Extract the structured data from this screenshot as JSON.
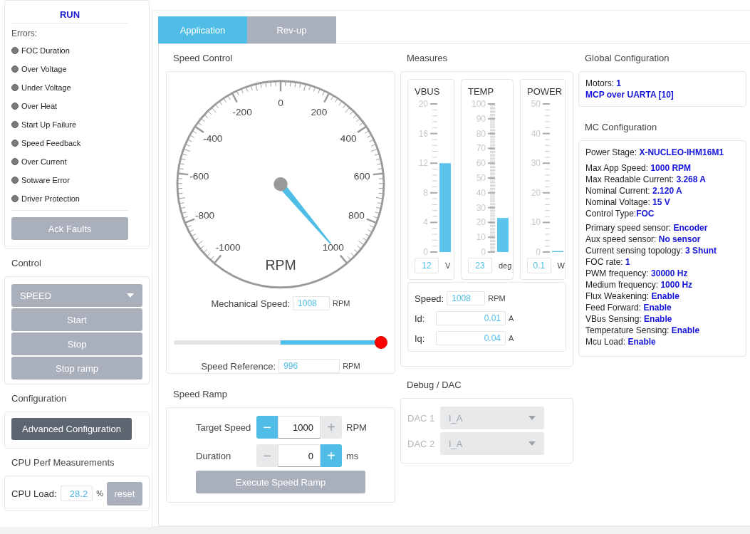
{
  "sidebar": {
    "status": "RUN",
    "errors_label": "Errors:",
    "errors": [
      {
        "label": "FOC Duration",
        "active": false
      },
      {
        "label": "Over Voltage",
        "active": false
      },
      {
        "label": "Under Voltage",
        "active": false
      },
      {
        "label": "Over Heat",
        "active": false
      },
      {
        "label": "Start Up Failure",
        "active": false
      },
      {
        "label": "Speed Feedback",
        "active": false
      },
      {
        "label": "Over Current",
        "active": false
      },
      {
        "label": "Sotware Error",
        "active": false
      },
      {
        "label": "Driver Protection",
        "active": false
      }
    ],
    "ack_button": "Ack Faults",
    "control": {
      "title": "Control",
      "mode": "SPEED",
      "buttons": [
        "Start",
        "Stop",
        "Stop ramp"
      ]
    },
    "configuration": {
      "title": "Configuration",
      "button": "Advanced Configuration"
    },
    "cpu": {
      "title": "CPU Perf Measurements",
      "label": "CPU Load:",
      "value": "28.2",
      "unit": "%",
      "button": "reset"
    }
  },
  "tabs": [
    {
      "label": "Application",
      "selected": true
    },
    {
      "label": "Rev-up",
      "selected": false
    }
  ],
  "speed_control": {
    "title": "Speed Control",
    "gauge": {
      "scale_labels": [
        "-1000",
        "-800",
        "-600",
        "-400",
        "-200",
        "0",
        "200",
        "400",
        "600",
        "800",
        "1000"
      ],
      "unit": "RPM",
      "level": 1
    },
    "mechanical_speed": {
      "label": "Mechanical Speed:",
      "value": "1008",
      "unit": "RPM"
    },
    "slider": {
      "level": 1
    },
    "speed_reference": {
      "label": "Speed Reference:",
      "value": "996",
      "unit": "RPM"
    }
  },
  "speed_ramp": {
    "title": "Speed Ramp",
    "rows": [
      {
        "label": "Target Speed",
        "value": "1000",
        "unit": "RPM",
        "minus": {
          "text": "−",
          "disabled": false
        },
        "plus": {
          "text": "+",
          "disabled": true
        }
      },
      {
        "label": "Duration",
        "value": "0",
        "unit": "ms",
        "minus": {
          "text": "−",
          "disabled": true
        },
        "plus": {
          "text": "+",
          "disabled": false
        }
      }
    ],
    "button": "Execute Speed Ramp"
  },
  "measures": {
    "title": "Measures",
    "meters": [
      {
        "name": "VBUS",
        "ticks": [
          "20",
          "16",
          "12",
          "8",
          "4",
          "0"
        ],
        "level": 0.6,
        "value": "12",
        "unit": "V"
      },
      {
        "name": "TEMP",
        "ticks": [
          "100",
          "90",
          "80",
          "70",
          "60",
          "50",
          "40",
          "30",
          "20",
          "10",
          "0"
        ],
        "level": 0.23,
        "value": "23",
        "unit": "deg"
      },
      {
        "name": "POWER",
        "ticks": [
          "50",
          "40",
          "30",
          "20",
          "10",
          "0"
        ],
        "level": 0.002,
        "value": "0.1",
        "unit": "W"
      }
    ],
    "readings": [
      {
        "kind": "short",
        "label": "Speed:",
        "value": "1008",
        "unit": "RPM"
      },
      {
        "kind": "wide",
        "label": "Id:",
        "value": "0.01",
        "unit": "A"
      },
      {
        "kind": "wide",
        "label": "Iq:",
        "value": "0.04",
        "unit": "A"
      }
    ]
  },
  "debug_dac": {
    "title": "Debug / DAC",
    "channels": [
      {
        "label": "DAC 1",
        "value": "I_A",
        "disabled": true
      },
      {
        "label": "DAC 2",
        "value": "I_A",
        "disabled": true
      }
    ]
  },
  "global_configuration": {
    "title": "Global Configuration",
    "lines": [
      {
        "kind": "pair",
        "text": "Motors: **1**"
      },
      {
        "kind": "value",
        "text": "MCP over UARTA [10]"
      }
    ]
  },
  "mc_configuration": {
    "title": "MC Configuration",
    "groups": [
      [
        "Power Stage: **X-NUCLEO-IHM16M1**"
      ],
      [
        "Max App Speed: **1000 RPM**",
        "Max Readable Current: **3.268 A**",
        "Nominal Current: **2.120 A**",
        "Nominal Voltage: **15 V**",
        "Control Type:**FOC**"
      ],
      [
        "Primary speed sensor: **Encoder**",
        "Aux speed sensor: **No sensor**",
        "Current sensing topology: **3 Shunt**",
        "FOC rate: **1**",
        "PWM frequency: **30000 Hz**",
        "Medium frequency: **1000 Hz**",
        "Flux Weakening: **Enable**",
        "Feed Forward: **Enable**",
        "VBus Sensing: **Enable**",
        "Temperature Sensing: **Enable**",
        "Mcu Load: **Enable**"
      ]
    ]
  }
}
